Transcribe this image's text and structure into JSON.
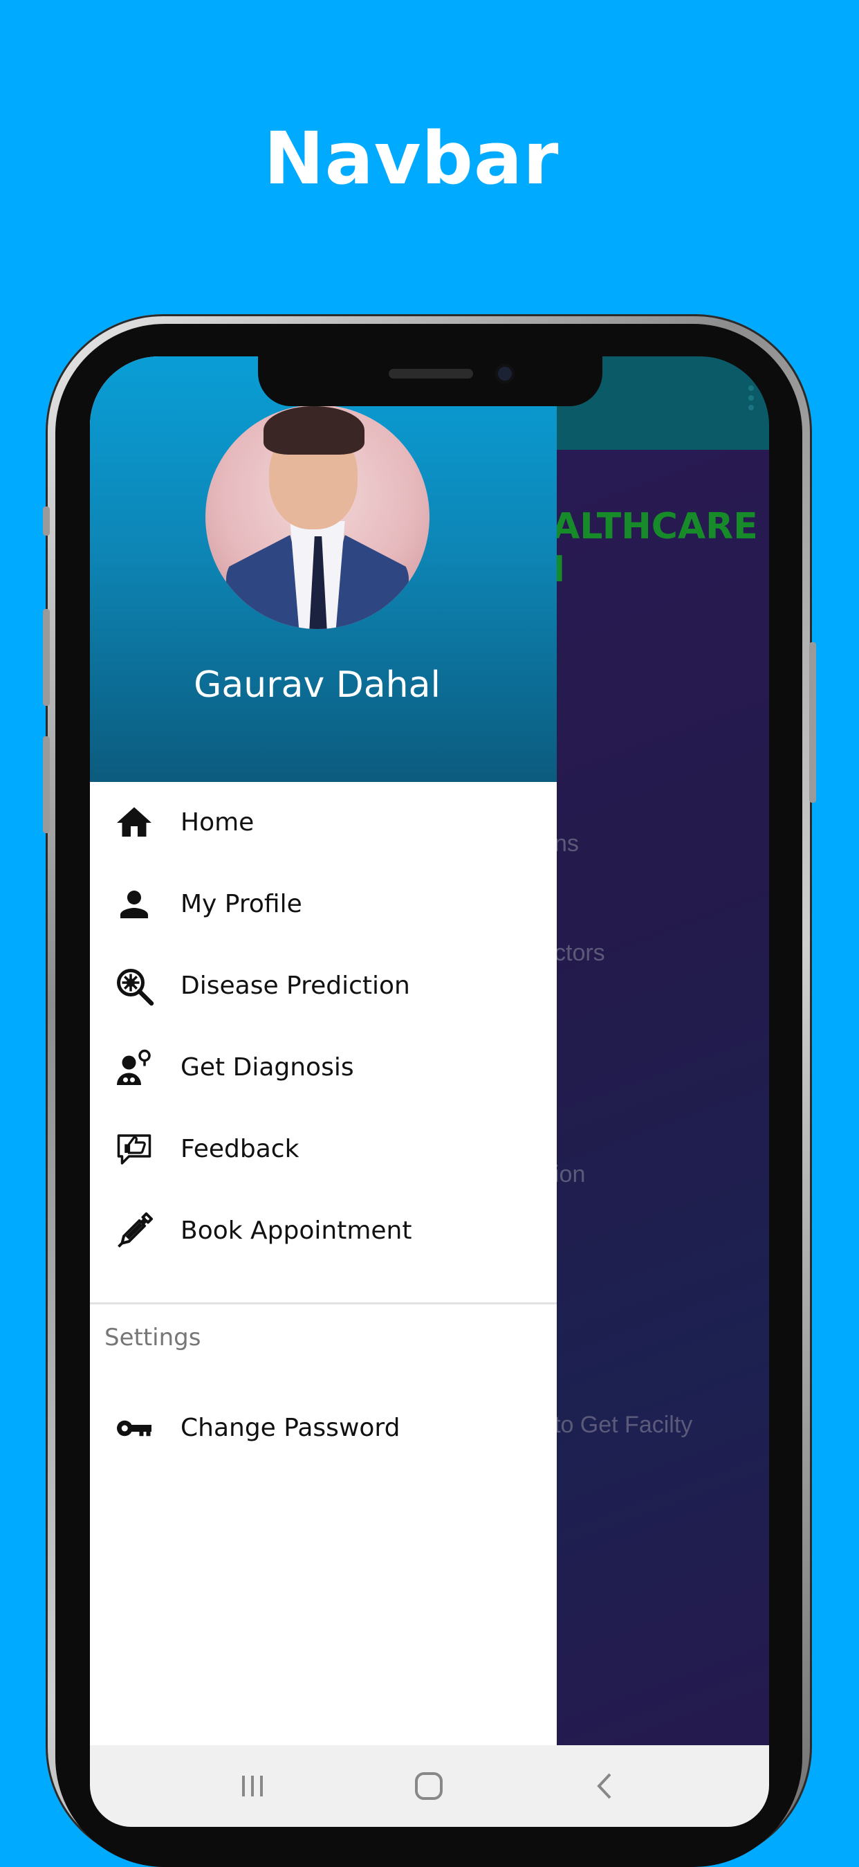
{
  "page": {
    "title": "Navbar"
  },
  "colors": {
    "page_background": "#00aaff",
    "drawer_header": "#0d86b6",
    "app_bar": "#0b5a67",
    "heading_green": "#178a2a"
  },
  "background_app": {
    "heading": "ALTHCARE\nI",
    "items": [
      "ns",
      "ctors",
      "ion",
      "to Get Facilty"
    ]
  },
  "drawer": {
    "user_name": "Gaurav Dahal",
    "avatar": "profile-photo",
    "items": [
      {
        "label": "Home",
        "icon": "home-icon"
      },
      {
        "label": "My Profile",
        "icon": "person-icon"
      },
      {
        "label": "Disease Prediction",
        "icon": "virus-search-icon"
      },
      {
        "label": "Get Diagnosis",
        "icon": "doctor-icon"
      },
      {
        "label": "Feedback",
        "icon": "thumbs-up-chat-icon"
      },
      {
        "label": "Book Appointment",
        "icon": "syringe-icon"
      }
    ],
    "settings": {
      "section_label": "Settings",
      "items": [
        {
          "label": "Change Password",
          "icon": "key-icon"
        }
      ]
    }
  },
  "system_nav": {
    "buttons": [
      "recents-button",
      "home-button",
      "back-button"
    ]
  }
}
